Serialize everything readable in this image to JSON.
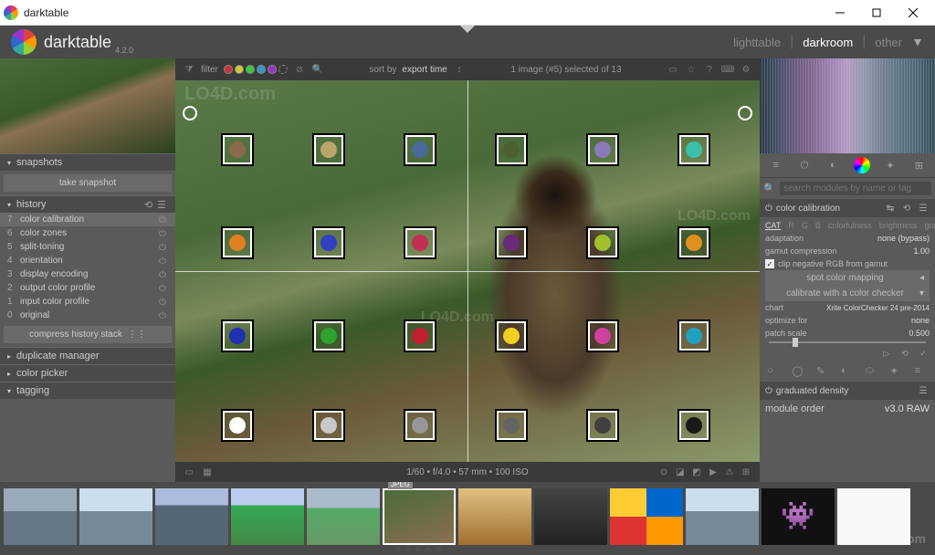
{
  "window": {
    "title": "darktable"
  },
  "app": {
    "brand": "darktable",
    "version": "4.2.0"
  },
  "modes": {
    "lighttable": "lighttable",
    "darkroom": "darkroom",
    "other": "other",
    "active": "darkroom"
  },
  "filter": {
    "label": "filter",
    "sort_by": "sort by",
    "sort_value": "export time",
    "selection": "1 image (#5) selected of 13"
  },
  "left": {
    "snapshots": {
      "title": "snapshots",
      "button": "take snapshot"
    },
    "history": {
      "title": "history",
      "items": [
        {
          "n": "7",
          "name": "color calibration"
        },
        {
          "n": "6",
          "name": "color zones"
        },
        {
          "n": "5",
          "name": "split-toning"
        },
        {
          "n": "4",
          "name": "orientation"
        },
        {
          "n": "3",
          "name": "display encoding"
        },
        {
          "n": "2",
          "name": "output color profile"
        },
        {
          "n": "1",
          "name": "input color profile"
        },
        {
          "n": "0",
          "name": "original"
        }
      ],
      "compress": "compress history stack"
    },
    "duplicate": {
      "title": "duplicate manager"
    },
    "colorpicker": {
      "title": "color picker"
    },
    "tagging": {
      "title": "tagging"
    }
  },
  "canvas": {
    "info": "1/60 • f/4.0 • 57 mm • 100 ISO",
    "patches": [
      {
        "r": 0,
        "c": 0,
        "color": "#8a6a4a"
      },
      {
        "r": 0,
        "c": 1,
        "color": "#baa56a"
      },
      {
        "r": 0,
        "c": 2,
        "color": "#4a6a9a"
      },
      {
        "r": 0,
        "c": 3,
        "color": "#4a6030"
      },
      {
        "r": 0,
        "c": 4,
        "color": "#8a7aba"
      },
      {
        "r": 0,
        "c": 5,
        "color": "#3ac0aa"
      },
      {
        "r": 1,
        "c": 0,
        "color": "#e08020"
      },
      {
        "r": 1,
        "c": 1,
        "color": "#3040c0"
      },
      {
        "r": 1,
        "c": 2,
        "color": "#c03050"
      },
      {
        "r": 1,
        "c": 3,
        "color": "#6a2a7a"
      },
      {
        "r": 1,
        "c": 4,
        "color": "#a0c030"
      },
      {
        "r": 1,
        "c": 5,
        "color": "#e09020"
      },
      {
        "r": 2,
        "c": 0,
        "color": "#2030b0"
      },
      {
        "r": 2,
        "c": 1,
        "color": "#30a030"
      },
      {
        "r": 2,
        "c": 2,
        "color": "#c02030"
      },
      {
        "r": 2,
        "c": 3,
        "color": "#f0d020"
      },
      {
        "r": 2,
        "c": 4,
        "color": "#d040a0"
      },
      {
        "r": 2,
        "c": 5,
        "color": "#20a0c0"
      },
      {
        "r": 3,
        "c": 0,
        "color": "#ffffff"
      },
      {
        "r": 3,
        "c": 1,
        "color": "#c8c8c8"
      },
      {
        "r": 3,
        "c": 2,
        "color": "#969696"
      },
      {
        "r": 3,
        "c": 3,
        "color": "#646464"
      },
      {
        "r": 3,
        "c": 4,
        "color": "#404040"
      },
      {
        "r": 3,
        "c": 5,
        "color": "#1a1a1a"
      }
    ]
  },
  "right": {
    "search_placeholder": "search modules by name or tag",
    "module": {
      "name": "color calibration",
      "tabs": [
        "CAT",
        "R",
        "G",
        "B",
        "colorfulness",
        "brightness",
        "gray"
      ],
      "active_tab": "CAT",
      "adaptation_label": "adaptation",
      "adaptation_val": "none (bypass)",
      "gamut_label": "gamut compression",
      "gamut_val": "1.00",
      "clip_label": "clip negative RGB from gamut",
      "spot_mapping": "spot color mapping",
      "calibrate": "calibrate with a color checker",
      "chart_label": "chart",
      "chart_val": "Xrite ColorChecker 24 pre-2014",
      "optimize_label": "optimize for",
      "optimize_val": "none",
      "patch_label": "patch scale",
      "patch_val": "0.500"
    },
    "graduated": "graduated density",
    "module_order_label": "module order",
    "module_order_val": "v3.0 RAW"
  },
  "filmstrip": {
    "tag_label": "JPEG",
    "thumbs": [
      {
        "bg": "linear-gradient(#9ab 40%,#678 40%)"
      },
      {
        "bg": "linear-gradient(#cde 40%,#789 40%)"
      },
      {
        "bg": "linear-gradient(#abd 30%,#567 30%)"
      },
      {
        "bg": "linear-gradient(#bce 30%,#3a5 30%,#484 100%)"
      },
      {
        "bg": "linear-gradient(#abc 35%,#5a6 35%,#696 100%)"
      },
      {
        "bg": "linear-gradient(160deg,#4a6b3a,#8a7050)"
      },
      {
        "bg": "linear-gradient(#e0c080,#a07030)"
      },
      {
        "bg": "linear-gradient(#444,#222)"
      },
      {
        "bg": "conic-gradient(#06c 0 90deg,#f90 90deg 180deg,#d33 180deg 270deg,#fc3 270deg)"
      },
      {
        "bg": "linear-gradient(#cde 40%,#789 40%)"
      },
      {
        "bg": "#111"
      },
      {
        "bg": "#f8f8f8"
      }
    ]
  },
  "watermark": "LO4D.com"
}
